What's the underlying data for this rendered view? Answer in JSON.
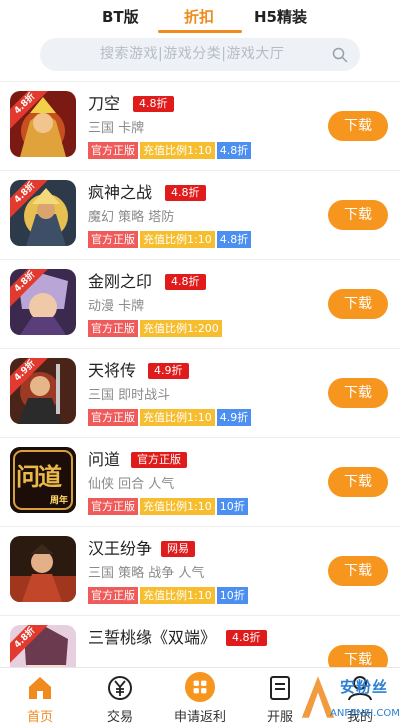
{
  "top_tabs": [
    {
      "label": "BT版"
    },
    {
      "label": "折扣"
    },
    {
      "label": "H5精装"
    }
  ],
  "search": {
    "placeholder": "搜索游戏|游戏分类|游戏大厅"
  },
  "games": [
    {
      "name": "刀空",
      "badge": "4.8折",
      "ribbon": "4.8折",
      "tags": "三国 卡牌",
      "labels": [
        "官方正版",
        "充值比例1:10",
        "4.8折"
      ],
      "download": "下载"
    },
    {
      "name": "疯神之战",
      "badge": "4.8折",
      "ribbon": "4.8折",
      "tags": "魔幻 策略 塔防",
      "labels": [
        "官方正版",
        "充值比例1:10",
        "4.8折"
      ],
      "download": "下载"
    },
    {
      "name": "金刚之印",
      "badge": "4.8折",
      "ribbon": "4.8折",
      "tags": "动漫 卡牌",
      "labels": [
        "官方正版",
        "充值比例1:200"
      ],
      "download": "下载"
    },
    {
      "name": "天将传",
      "badge": "4.9折",
      "ribbon": "4.9折",
      "tags": "三国 即时战斗",
      "labels": [
        "官方正版",
        "充值比例1:10",
        "4.9折"
      ],
      "download": "下载"
    },
    {
      "name": "问道",
      "badge": "官方正版",
      "icon_text": "问道",
      "icon_sub": "周年",
      "tags": "仙侠 回合 人气",
      "labels": [
        "官方正版",
        "充值比例1:10",
        "10折"
      ],
      "download": "下载"
    },
    {
      "name": "汉王纷争",
      "badge": "网易",
      "tags": "三国 策略 战争 人气",
      "labels": [
        "官方正版",
        "充值比例1:10",
        "10折"
      ],
      "download": "下载"
    },
    {
      "name": "三誓桃缘《双端》",
      "badge": "4.8折",
      "ribbon": "4.8折",
      "download": "下载"
    }
  ],
  "bottom_nav": [
    {
      "label": "首页",
      "icon": "home-icon"
    },
    {
      "label": "交易",
      "icon": "yen-icon"
    },
    {
      "label": "申请返利",
      "icon": "grid-icon"
    },
    {
      "label": "开服",
      "icon": "server-icon"
    },
    {
      "label": "我的",
      "icon": "user-icon"
    }
  ],
  "watermark": {
    "text": "安粉丝",
    "sub": "ANFENSI.COM"
  },
  "colors": {
    "accent": "#f08a1c",
    "download": "#f6961e",
    "badge": "#e01b1b",
    "label_red": "#ef5a5a",
    "label_yellow": "#f6be2e",
    "label_blue": "#4b8ff0"
  }
}
